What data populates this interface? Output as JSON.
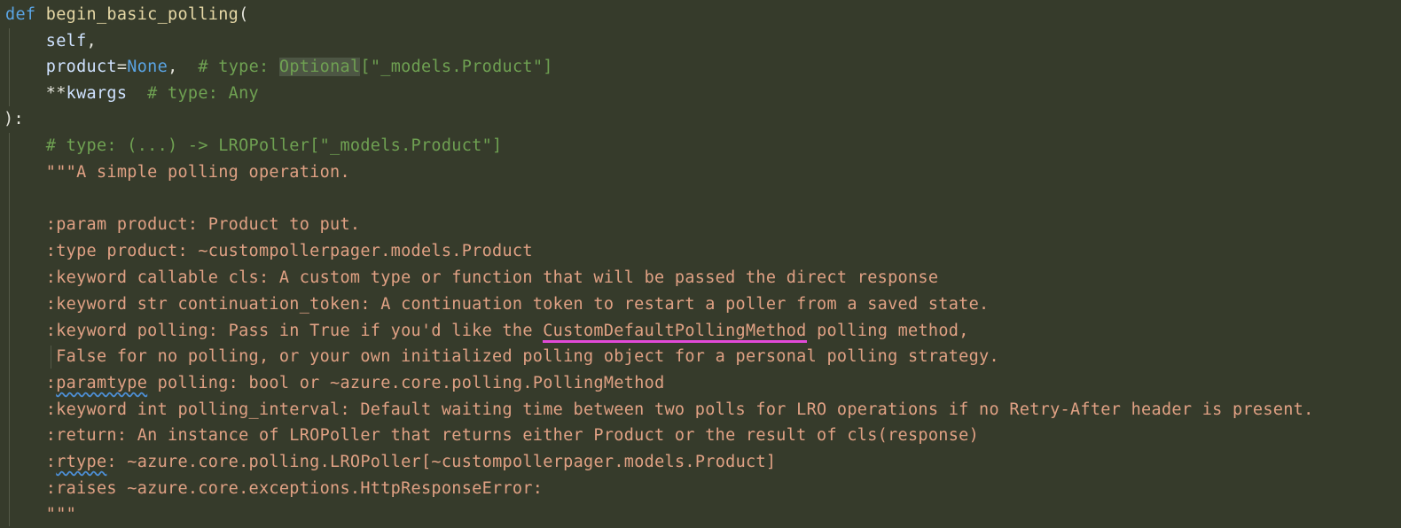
{
  "lines": {
    "l1": {
      "kw": "def",
      "fn": "begin_basic_polling",
      "paren": "("
    },
    "l2": {
      "self": "self",
      "comma": ","
    },
    "l3": {
      "param": "product",
      "eq": "=",
      "none": "None",
      "comma": ",",
      "cmt_pre": "  # type: ",
      "hl": "Optional",
      "cmt_post": "[\"_models.Product\"]"
    },
    "l4": {
      "stars": "**",
      "param": "kwargs",
      "cmt": "  # type: Any"
    },
    "l5": {
      "text": "):"
    },
    "l6": {
      "cmt": "# type: (...) -> LROPoller[\"_models.Product\"]"
    },
    "l7": {
      "text": "\"\"\"A simple polling operation."
    },
    "l8": {
      "text": ""
    },
    "l9": {
      "text": ":param product: Product to put."
    },
    "l10": {
      "text": ":type product: ~custompollerpager.models.Product"
    },
    "l11": {
      "text": ":keyword callable cls: A custom type or function that will be passed the direct response"
    },
    "l12": {
      "text": ":keyword str continuation_token: A continuation token to restart a poller from a saved state."
    },
    "l13": {
      "pre": ":keyword polling: Pass in True if you'd like the ",
      "link": "CustomDefaultPollingMethod",
      "post": " polling method,"
    },
    "l14": {
      "text": " False for no polling, or your own initialized polling object for a personal polling strategy."
    },
    "l15": {
      "pre": ":",
      "squiggle": "paramtype",
      "post": " polling: bool or ~azure.core.polling.PollingMethod"
    },
    "l16": {
      "text": ":keyword int polling_interval: Default waiting time between two polls for LRO operations if no Retry-After header is present."
    },
    "l17": {
      "text": ":return: An instance of LROPoller that returns either Product or the result of cls(response)"
    },
    "l18": {
      "pre": ":",
      "squiggle": "rtype",
      "post": ": ~azure.core.polling.LROPoller[~custompollerpager.models.Product]"
    },
    "l19": {
      "text": ":raises ~azure.core.exceptions.HttpResponseError:"
    },
    "l20": {
      "text": "\"\"\""
    }
  },
  "colors": {
    "background": "#363b2b",
    "keyword": "#5aa4e3",
    "function": "#e6d8a6",
    "comment": "#6fa152",
    "docstring": "#e0a184",
    "link_underline": "#e24ad8",
    "squiggle": "#4d8fd6"
  }
}
